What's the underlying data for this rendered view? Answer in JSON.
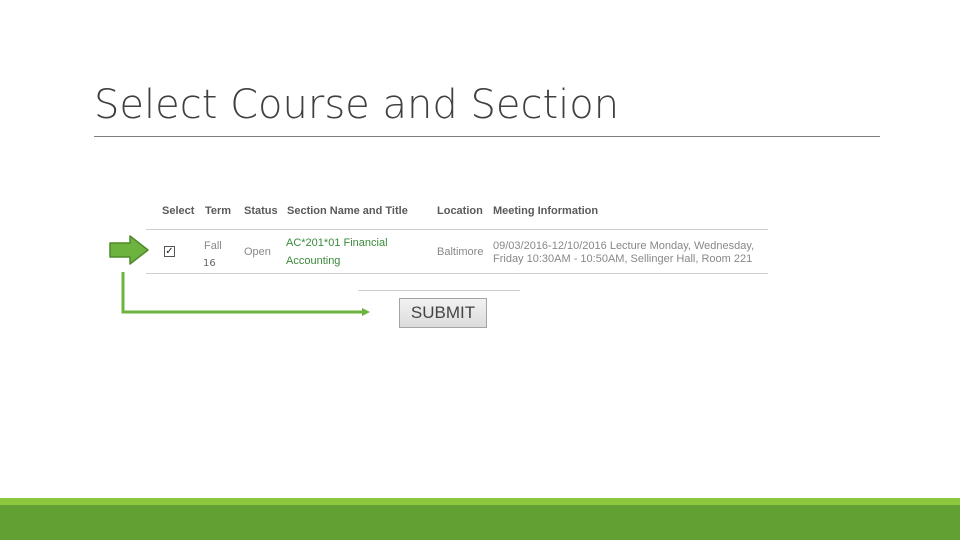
{
  "slide": {
    "title": "Select Course and Section"
  },
  "table": {
    "headers": [
      "Select",
      "Term",
      "Status",
      "Section Name and Title",
      "Location",
      "Meeting Information"
    ],
    "row": {
      "selected": true,
      "term_line1": "Fall",
      "term_line2": "16",
      "status": "Open",
      "section_line1": "AC*201*01 Financial",
      "section_line2": "Accounting",
      "location": "Baltimore",
      "meeting_line1": "09/03/2016-12/10/2016 Lecture Monday, Wednesday,",
      "meeting_line2": "Friday 10:30AM - 10:50AM, Sellinger Hall, Room 221"
    }
  },
  "submit": {
    "label": "SUBMIT"
  },
  "colors": {
    "arrow_fill": "#6cb33f",
    "arrow_stroke": "#4f8a2a",
    "footer_light": "#8dc63f",
    "footer_dark": "#62a033",
    "link_green": "#3a8a3a"
  },
  "icons": {
    "pointer": "right-arrow-icon",
    "connector": "elbow-arrow-icon",
    "checkbox": "checkmark-icon"
  }
}
